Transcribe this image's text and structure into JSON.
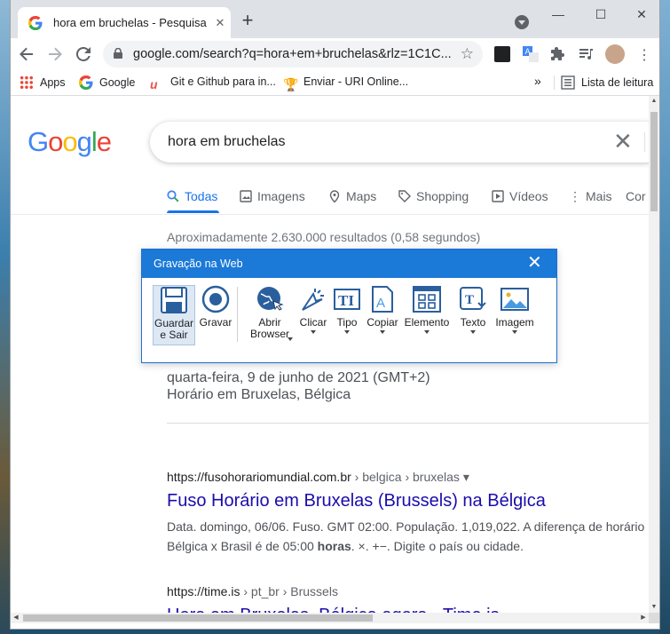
{
  "browser": {
    "tab_title": "hora em bruchelas - Pesquisa Go",
    "tab_close": "✕",
    "new_tab": "+",
    "window_controls": [
      "—",
      "☐",
      "✕"
    ],
    "url": "google.com/search?q=hora+em+bruchelas&rlz=1C1C...",
    "bookmarks": [
      {
        "label": "Apps"
      },
      {
        "label": "Google"
      },
      {
        "label": "Git e Github para in..."
      },
      {
        "label": "Enviar - URI Online..."
      }
    ],
    "bookmarks_more": "»",
    "reading_list": "Lista de leitura"
  },
  "google": {
    "query": "hora em bruchelas",
    "tabs": [
      "Todas",
      "Imagens",
      "Maps",
      "Shopping",
      "Vídeos",
      "Mais",
      "Cor"
    ],
    "stats": "Aproximadamente 2.630.000 resultados (0,58 segundos)",
    "answer_date": "quarta-feira, 9 de junho de 2021 (GMT+2)",
    "answer_place": "Horário em Bruxelas, Bélgica",
    "results": [
      {
        "cite": "https://fusohorariomundial.com.br",
        "crumb": " › belgica › bruxelas ▾",
        "title": "Fuso Horário em Bruxelas (Brussels) na Bélgica",
        "snippet_1": "Data. domingo, 06/06. Fuso. GMT 02:00. População. 1,019,022. A diferença de horário",
        "snippet_2a": "Bélgica x Brasil é de 05:00 ",
        "snippet_2b": "horas",
        "snippet_2c": ". ×. +−. Digite o país ou cidade."
      },
      {
        "cite": "https://time.is",
        "crumb": " › pt_br › Brussels",
        "title": "Hora em Bruxelas, Bélgica agora - Time.is"
      }
    ]
  },
  "recorder": {
    "title": "Gravação na Web",
    "close": "✕",
    "buttons": [
      {
        "label": "Guardar e Sair"
      },
      {
        "label": "Gravar"
      },
      {
        "label": "Abrir Browser"
      },
      {
        "label": "Clicar"
      },
      {
        "label": "Tipo"
      },
      {
        "label": "Copiar"
      },
      {
        "label": "Elemento"
      },
      {
        "label": "Texto"
      },
      {
        "label": "Imagem"
      }
    ]
  }
}
